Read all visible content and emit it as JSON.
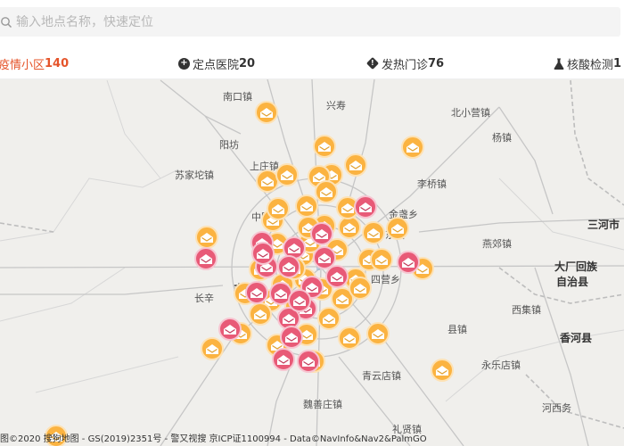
{
  "search": {
    "placeholder": "输入地点名称，快速定位",
    "icon": "search-icon"
  },
  "tabs": [
    {
      "label": "疫情小区",
      "count": "140",
      "icon": "",
      "active": true
    },
    {
      "label": "定点医院",
      "count": "20",
      "icon": "plus-circle-icon",
      "active": false
    },
    {
      "label": "发热门诊",
      "count": "76",
      "icon": "diamond-icon",
      "active": false
    },
    {
      "label": "核酸检测",
      "count": "1",
      "icon": "flask-icon",
      "active": false
    }
  ],
  "map": {
    "places": [
      {
        "name": "南口镇",
        "kind": "town"
      },
      {
        "name": "兴寿",
        "kind": "town"
      },
      {
        "name": "北小营镇",
        "kind": "town"
      },
      {
        "name": "阳坊",
        "kind": "town"
      },
      {
        "name": "杨镇",
        "kind": "town"
      },
      {
        "name": "上庄镇",
        "kind": "town"
      },
      {
        "name": "苏家坨镇",
        "kind": "town"
      },
      {
        "name": "李桥镇",
        "kind": "town"
      },
      {
        "name": "中国人",
        "kind": "town"
      },
      {
        "name": "金盏乡",
        "kind": "town"
      },
      {
        "name": "东坝",
        "kind": "town"
      },
      {
        "name": "三河市",
        "kind": "city"
      },
      {
        "name": "燕郊镇",
        "kind": "town"
      },
      {
        "name": "丰台",
        "kind": "city"
      },
      {
        "name": "大厂回族",
        "kind": "city"
      },
      {
        "name": "自治县",
        "kind": "city"
      },
      {
        "name": "长辛",
        "kind": "town"
      },
      {
        "name": "四营乡",
        "kind": "town"
      },
      {
        "name": "西集镇",
        "kind": "town"
      },
      {
        "name": "县镇",
        "kind": "town"
      },
      {
        "name": "香河县",
        "kind": "city"
      },
      {
        "name": "永乐店镇",
        "kind": "town"
      },
      {
        "name": "青云店镇",
        "kind": "town"
      },
      {
        "name": "魏善庄镇",
        "kind": "town"
      },
      {
        "name": "河西务",
        "kind": "town"
      },
      {
        "name": "礼贤镇",
        "kind": "town"
      }
    ],
    "markers": {
      "community_count": 48,
      "hospital_count": 21
    },
    "colors": {
      "community": "#fbb341",
      "hospital": "#e85a77",
      "accent": "#e5542a"
    }
  },
  "footer": {
    "left_fragment": "图",
    "copyright": "©2020 搜狗地图 - GS(2019)2351号 - 警又视搜 京ICP证1100994 - Data©NavInfo&Nav2&PalmGO"
  }
}
